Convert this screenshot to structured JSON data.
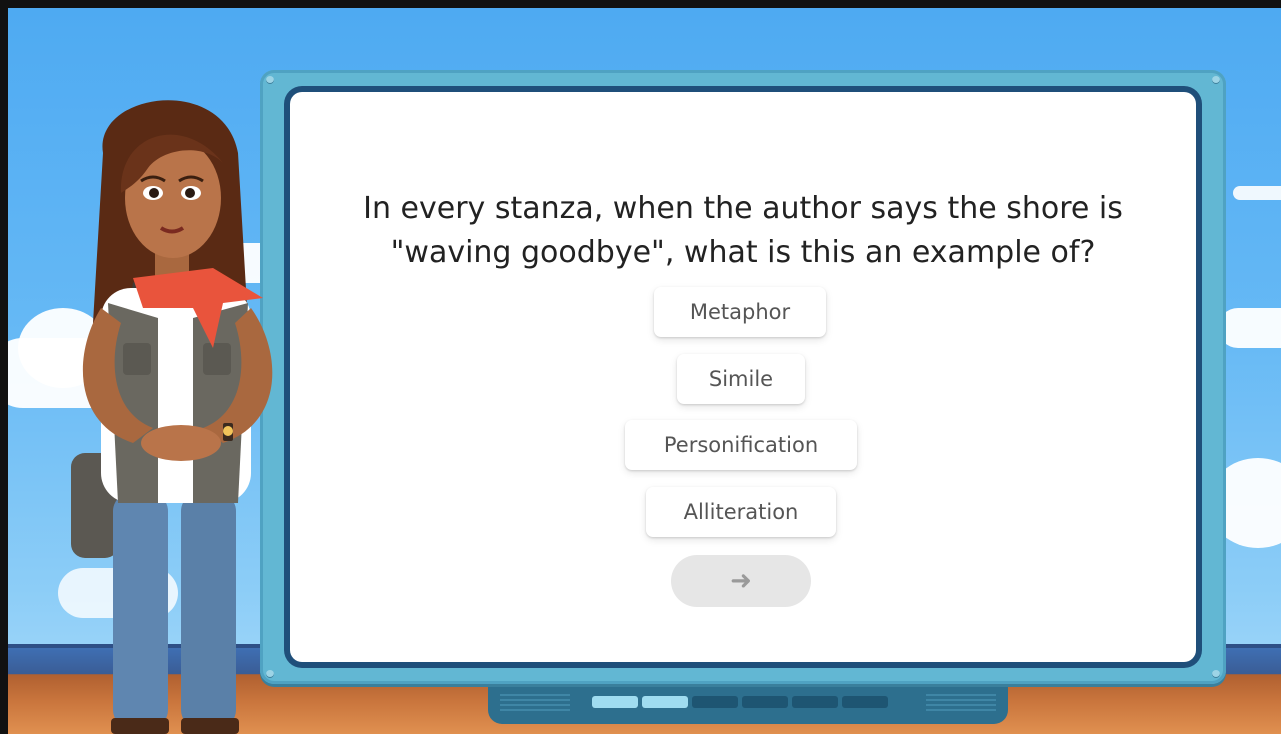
{
  "quiz": {
    "question": "In every stanza, when the author says the shore is \"waving goodbye\", what is this an example of?",
    "options": [
      "Metaphor",
      "Simile",
      "Personification",
      "Alliteration"
    ],
    "next_icon": "arrow-right-icon",
    "progress": {
      "completed": 2,
      "total": 6
    }
  },
  "colors": {
    "sky": "#5bb2f3",
    "board_frame": "#62b7d3",
    "board_border": "#1f4f7a",
    "next_button": "#e6e6e6"
  }
}
